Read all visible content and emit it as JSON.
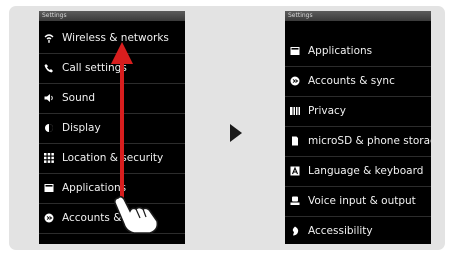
{
  "left_screen": {
    "status_title": "Settings",
    "items": [
      {
        "label": "Wireless & networks",
        "icon": "wifi-icon"
      },
      {
        "label": "Call settings",
        "icon": "phone-icon"
      },
      {
        "label": "Sound",
        "icon": "speaker-icon"
      },
      {
        "label": "Display",
        "icon": "brightness-icon"
      },
      {
        "label": "Location & security",
        "icon": "location-grid-icon"
      },
      {
        "label": "Applications",
        "icon": "applications-icon"
      },
      {
        "label": "Accounts & sync",
        "icon": "sync-icon"
      },
      {
        "label": "",
        "icon": "privacy-icon"
      }
    ]
  },
  "right_screen": {
    "status_title": "Settings",
    "items": [
      {
        "label": "Applications",
        "icon": "applications-icon"
      },
      {
        "label": "Accounts & sync",
        "icon": "sync-icon"
      },
      {
        "label": "Privacy",
        "icon": "privacy-icon"
      },
      {
        "label": "microSD & phone storage",
        "icon": "sd-card-icon"
      },
      {
        "label": "Language & keyboard",
        "icon": "keyboard-icon"
      },
      {
        "label": "Voice input & output",
        "icon": "voice-icon"
      },
      {
        "label": "Accessibility",
        "icon": "accessibility-icon"
      }
    ]
  },
  "colors": {
    "panel": "#e3e3e3",
    "screen": "#000000",
    "text": "#f2f2f2",
    "swipe_arrow": "#d81e1e",
    "next_arrow": "#1a1a1a"
  }
}
